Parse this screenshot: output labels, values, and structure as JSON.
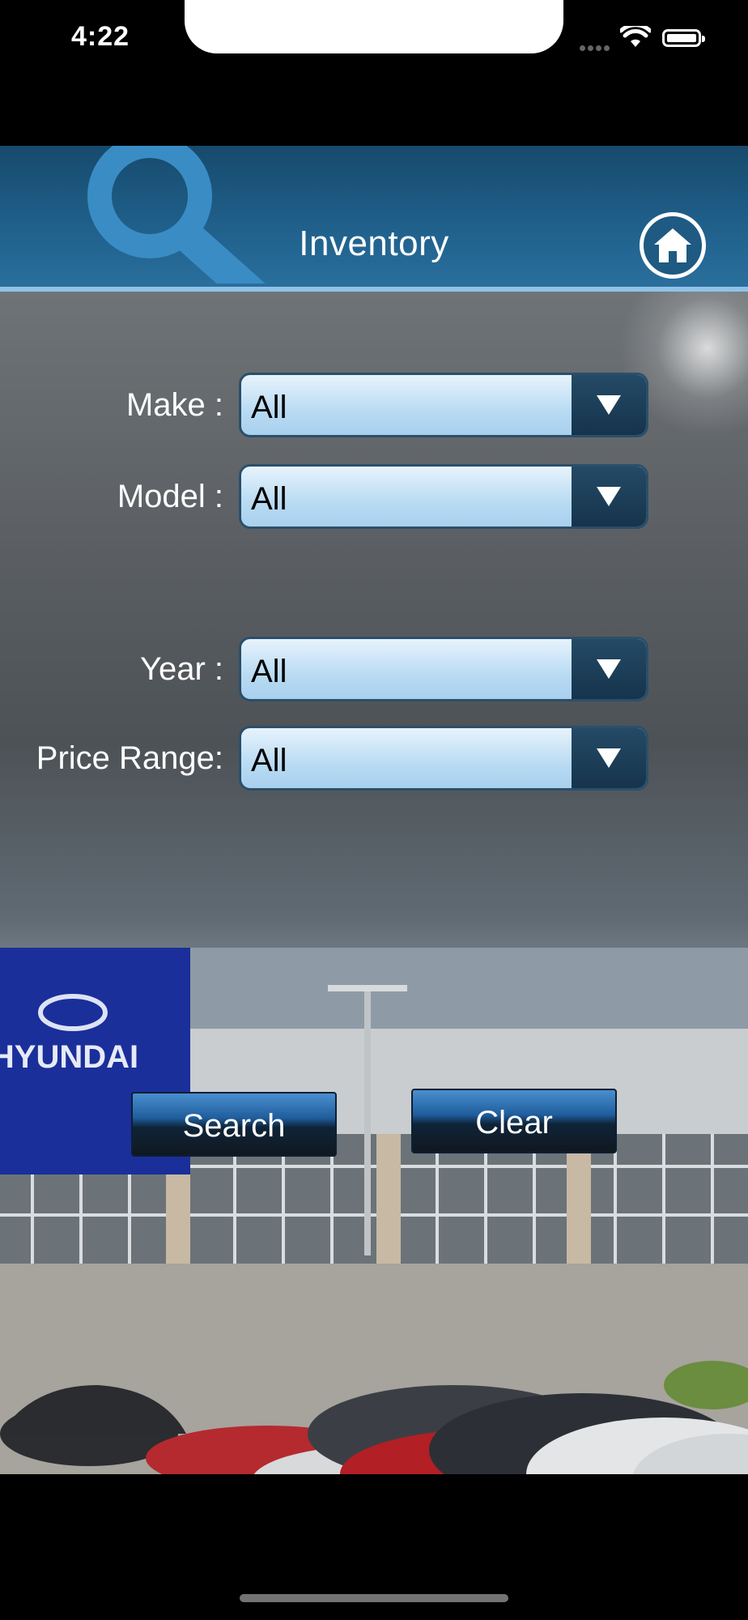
{
  "status_bar": {
    "time": "4:22"
  },
  "header": {
    "title": "Inventory"
  },
  "form": {
    "make": {
      "label": "Make :",
      "value": "All"
    },
    "model": {
      "label": "Model :",
      "value": "All"
    },
    "year": {
      "label": "Year :",
      "value": "All"
    },
    "price_range": {
      "label": "Price Range:",
      "value": "All"
    }
  },
  "background": {
    "dealership_sign": "HYUNDAI"
  },
  "actions": {
    "search_label": "Search",
    "clear_label": "Clear"
  },
  "colors": {
    "header": "#1f5f8a",
    "header_border": "#8fc3e8",
    "select_fill": "#b9dbf3",
    "select_arrow": "#16344c",
    "dealership_blue": "#1a2f9a"
  }
}
